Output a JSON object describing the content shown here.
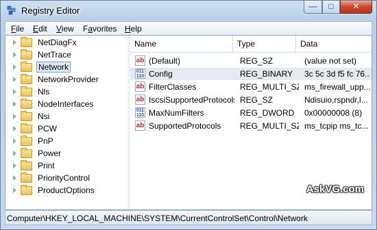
{
  "window": {
    "title": "Registry Editor"
  },
  "titlebar_buttons": {
    "minimize": "—",
    "maximize": "□",
    "close": "✕"
  },
  "menu": [
    {
      "label": "File",
      "mnemonic": "F",
      "rest": "ile"
    },
    {
      "label": "Edit",
      "mnemonic": "E",
      "rest": "dit"
    },
    {
      "label": "View",
      "mnemonic": "V",
      "rest": "iew"
    },
    {
      "label": "Favorites",
      "mnemonic": "a",
      "pre": "F",
      "rest": "vorites"
    },
    {
      "label": "Help",
      "mnemonic": "H",
      "rest": "elp"
    }
  ],
  "tree": {
    "items": [
      {
        "label": "NetDiagFx"
      },
      {
        "label": "NetTrace"
      },
      {
        "label": "Network",
        "selected": true
      },
      {
        "label": "NetworkProvider"
      },
      {
        "label": "Nls"
      },
      {
        "label": "NodeInterfaces"
      },
      {
        "label": "Nsi"
      },
      {
        "label": "PCW"
      },
      {
        "label": "PnP"
      },
      {
        "label": "Power"
      },
      {
        "label": "Print"
      },
      {
        "label": "PriorityControl"
      },
      {
        "label": "ProductOptions"
      }
    ]
  },
  "list": {
    "columns": {
      "name": "Name",
      "type": "Type",
      "data": "Data"
    },
    "rows": [
      {
        "name": "(Default)",
        "type": "REG_SZ",
        "data": "(value not set)",
        "icon": "string-value-icon"
      },
      {
        "name": "Config",
        "type": "REG_BINARY",
        "data": "3c 5c 3d f5 fc 76...",
        "icon": "binary-value-icon",
        "selected": true
      },
      {
        "name": "FilterClasses",
        "type": "REG_MULTI_SZ",
        "data": "ms_firewall_upp...",
        "icon": "string-value-icon"
      },
      {
        "name": "IscsiSupportedProtocols",
        "type": "REG_SZ",
        "data": "Ndisuio,rspndr,l...",
        "icon": "string-value-icon"
      },
      {
        "name": "MaxNumFilters",
        "type": "REG_DWORD",
        "data": "0x00000008 (8)",
        "icon": "binary-value-icon"
      },
      {
        "name": "SupportedProtocols",
        "type": "REG_MULTI_SZ",
        "data": "ms_tcpip ms_tc...",
        "icon": "string-value-icon"
      }
    ]
  },
  "status": {
    "path": "Computer\\HKEY_LOCAL_MACHINE\\SYSTEM\\CurrentControlSet\\Control\\Network"
  },
  "watermark": "AskVG.com",
  "icon_glyphs": {
    "string": "ab",
    "binary_line1": "011",
    "binary_line2": "110"
  }
}
